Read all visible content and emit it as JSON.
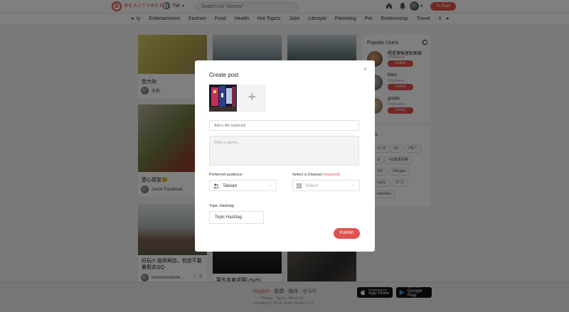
{
  "header": {
    "logo_text": "BEAUTYBEE",
    "region_code": "TW",
    "search_placeholder": "Search for \"disney\"",
    "post_button": "Post"
  },
  "categories": [
    "ty",
    "Entertainment",
    "Fashion",
    "Food",
    "Health",
    "Hot Topics",
    "Jobs",
    "Lifestyle",
    "Parenting",
    "Pet",
    "Relationship",
    "Travel",
    "We"
  ],
  "feed": {
    "cards": [
      {
        "title": "發大財",
        "user": "多則"
      },
      {
        "title": "愛心便當😊",
        "user": "Jason Facebook"
      },
      {
        "title": "好玩!!! 值得再訪，但是不要暑假去QQ",
        "user": "oneoneonoone...",
        "likes": "0"
      },
      {
        "title": "要去本東成碼(ﾉ•̀ω•́)ﾉ"
      }
    ]
  },
  "sidebar": {
    "popular_title": "Popular Users",
    "users": [
      {
        "name": "喂是實驗者對面樂",
        "followers": "0 followers",
        "follow": "Follow"
      },
      {
        "name": "Mars",
        "followers": "0 followers",
        "follow": "Follow"
      },
      {
        "name": "gooda",
        "followers": "0 followers",
        "follow": "Follow"
      }
    ],
    "tags_title": "Tags",
    "tags": [
      "#小光",
      "#ot",
      "#吃人",
      "ar",
      "#台東旅遊等",
      "345",
      "#blogger",
      "mgrls",
      "#7-11",
      "elebrities"
    ]
  },
  "footer": {
    "lang_active": "English",
    "langs": "· 繁體 · 簡体 · 한국어",
    "links": "Privacy · Terms · About Us",
    "copyright": "Priceologi © 2019 · Build Version 1.0.1",
    "appstore_small": "Download on the",
    "appstore_big": "App Store",
    "gplay_small": "GET IT ON",
    "gplay_big": "Google Play"
  },
  "modal": {
    "title": "Create post",
    "close": "×",
    "add_media": "+",
    "title_placeholder": "Add a title (optional)",
    "caption_placeholder": "Write a caption...",
    "audience_label": "Preferred audience",
    "audience_value": "Taiwan",
    "channel_label": "Select a Channel",
    "channel_required": "(required)",
    "channel_placeholder": "Select",
    "hashtag_label": "Topic Hashtag",
    "hashtag_value": "Topic Hashtag",
    "publish": "Publish"
  },
  "colors": {
    "accent": "#e0524f",
    "overlay": "rgba(0,0,0,0.5)"
  }
}
